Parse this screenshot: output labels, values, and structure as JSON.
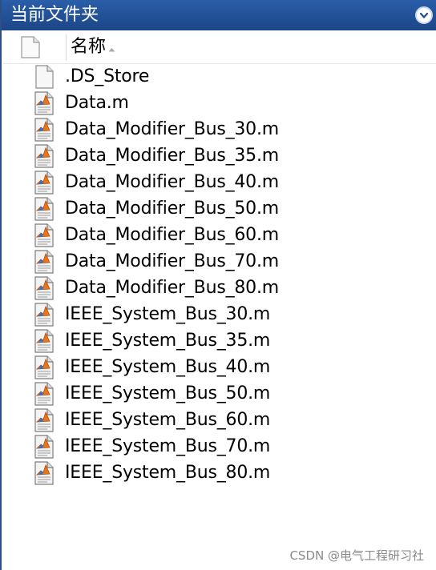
{
  "panel": {
    "title": "当前文件夹",
    "menu_icon": "chevron-down-circle-icon"
  },
  "header": {
    "type_icon": "blank-file-icon",
    "name_label": "名称",
    "sort_icon": "sort-ascending-icon"
  },
  "files": [
    {
      "name": ".DS_Store",
      "icon": "blank-file-icon"
    },
    {
      "name": "Data.m",
      "icon": "matlab-script-icon"
    },
    {
      "name": "Data_Modifier_Bus_30.m",
      "icon": "matlab-script-icon"
    },
    {
      "name": "Data_Modifier_Bus_35.m",
      "icon": "matlab-script-icon"
    },
    {
      "name": "Data_Modifier_Bus_40.m",
      "icon": "matlab-script-icon"
    },
    {
      "name": "Data_Modifier_Bus_50.m",
      "icon": "matlab-script-icon"
    },
    {
      "name": "Data_Modifier_Bus_60.m",
      "icon": "matlab-script-icon"
    },
    {
      "name": "Data_Modifier_Bus_70.m",
      "icon": "matlab-script-icon"
    },
    {
      "name": "Data_Modifier_Bus_80.m",
      "icon": "matlab-script-icon"
    },
    {
      "name": "IEEE_System_Bus_30.m",
      "icon": "matlab-script-icon"
    },
    {
      "name": "IEEE_System_Bus_35.m",
      "icon": "matlab-script-icon"
    },
    {
      "name": "IEEE_System_Bus_40.m",
      "icon": "matlab-script-icon"
    },
    {
      "name": "IEEE_System_Bus_50.m",
      "icon": "matlab-script-icon"
    },
    {
      "name": "IEEE_System_Bus_60.m",
      "icon": "matlab-script-icon"
    },
    {
      "name": "IEEE_System_Bus_70.m",
      "icon": "matlab-script-icon"
    },
    {
      "name": "IEEE_System_Bus_80.m",
      "icon": "matlab-script-icon"
    }
  ],
  "watermark": "CSDN @电气工程研习社",
  "colors": {
    "titlebar": "#1f4d93",
    "title_text": "#ffffff",
    "list_background": "#ffffff",
    "matlab_orange": "#e8741c",
    "watermark_text": "#8a8a8a"
  }
}
